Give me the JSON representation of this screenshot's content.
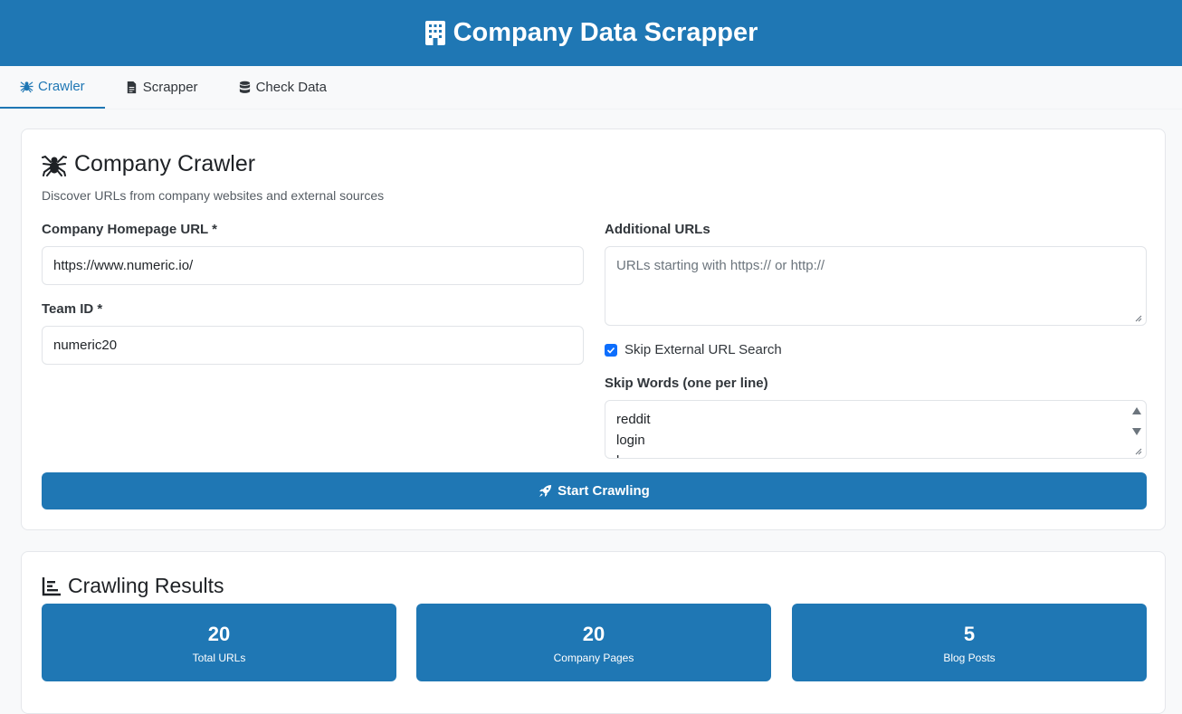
{
  "header": {
    "title": "Company Data Scrapper",
    "icon": "building-icon"
  },
  "tabs": [
    {
      "label": "Crawler",
      "icon": "spider-icon",
      "active": true
    },
    {
      "label": "Scrapper",
      "icon": "file-icon",
      "active": false
    },
    {
      "label": "Check Data",
      "icon": "database-icon",
      "active": false
    }
  ],
  "crawler": {
    "title": "Company Crawler",
    "subtitle": "Discover URLs from company websites and external sources",
    "homepage_label": "Company Homepage URL *",
    "homepage_value": "https://www.numeric.io/",
    "team_label": "Team ID *",
    "team_value": "numeric20",
    "additional_label": "Additional URLs",
    "additional_placeholder": "URLs starting with https:// or http://",
    "skip_external_label": "Skip External URL Search",
    "skip_external_checked": true,
    "skip_words_label": "Skip Words (one per line)",
    "skip_words": [
      "reddit",
      "login",
      "l"
    ],
    "start_button": "Start Crawling"
  },
  "results": {
    "title": "Crawling Results",
    "stats": [
      {
        "value": "20",
        "label": "Total URLs"
      },
      {
        "value": "20",
        "label": "Company Pages"
      },
      {
        "value": "5",
        "label": "Blog Posts"
      }
    ]
  },
  "colors": {
    "primary": "#1f77b4",
    "checkbox": "#0d6efd"
  }
}
